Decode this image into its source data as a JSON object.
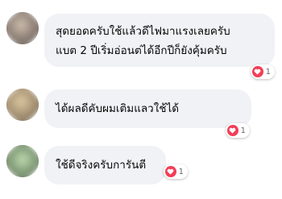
{
  "comments": [
    {
      "lines": [
        "สุดยอดครับใช้แล้วดีไฟมาแรงเลยครับ",
        "แบต 2 ปีเริ่มอ่อนต่ได้อีกปีก็ยังคุ้มครับ"
      ],
      "reaction_icon": "heart-icon",
      "reaction_count": "1"
    },
    {
      "lines": [
        "ได้ผลดีคับผมเติมแลวใช้ได้"
      ],
      "reaction_icon": "heart-icon",
      "reaction_count": "1"
    },
    {
      "lines": [
        "ใช้ดีจริงครับการันตี"
      ],
      "reaction_icon": "heart-icon",
      "reaction_count": "1"
    }
  ],
  "colors": {
    "bubble_bg": "#f0f2f5",
    "heart": "#f33e58",
    "text": "#050505",
    "count": "#65676b"
  }
}
